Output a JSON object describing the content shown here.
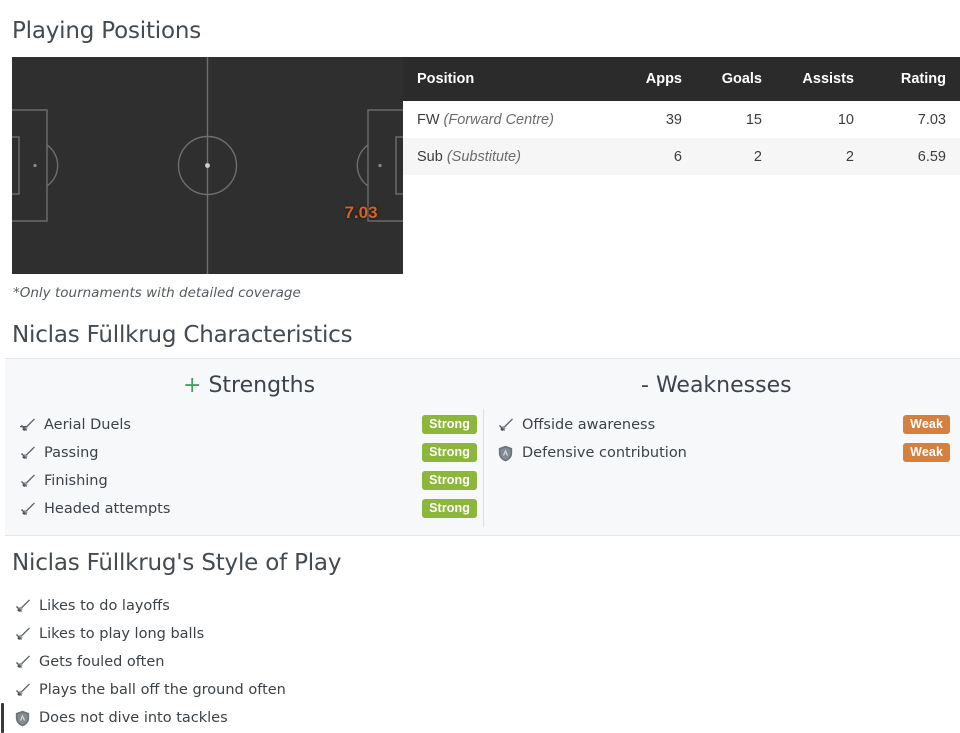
{
  "playing_positions": {
    "title": "Playing Positions",
    "footnote": "*Only tournaments with detailed coverage",
    "pitch": {
      "rating_marker": "7.03",
      "rating_color": "#d2622a",
      "background_color": "#2f2f2f",
      "line_color": "#6a6a6a"
    },
    "table": {
      "columns": [
        "Position",
        "Apps",
        "Goals",
        "Assists",
        "Rating"
      ],
      "rows": [
        {
          "code": "FW",
          "name": "(Forward Centre)",
          "apps": "39",
          "goals": "15",
          "assists": "10",
          "rating": "7.03"
        },
        {
          "code": "Sub",
          "name": "(Substitute)",
          "apps": "6",
          "goals": "2",
          "assists": "2",
          "rating": "6.59"
        }
      ]
    }
  },
  "characteristics": {
    "title": "Niclas Füllkrug Characteristics",
    "strengths": {
      "sign": "+",
      "heading": "Strengths",
      "items": [
        {
          "icon": "sword-icon",
          "label": "Aerial Duels",
          "badge": "Strong"
        },
        {
          "icon": "sword-icon",
          "label": "Passing",
          "badge": "Strong"
        },
        {
          "icon": "sword-icon",
          "label": "Finishing",
          "badge": "Strong"
        },
        {
          "icon": "sword-icon",
          "label": "Headed attempts",
          "badge": "Strong"
        }
      ]
    },
    "weaknesses": {
      "sign": "-",
      "heading": "Weaknesses",
      "items": [
        {
          "icon": "sword-icon",
          "label": "Offside awareness",
          "badge": "Weak"
        },
        {
          "icon": "shield-icon",
          "label": "Defensive contribution",
          "badge": "Weak"
        }
      ]
    },
    "badge_colors": {
      "strong": "#8cb63c",
      "weak": "#d4803f"
    }
  },
  "style_of_play": {
    "title": "Niclas Füllkrug's Style of Play",
    "items": [
      {
        "icon": "sword-icon",
        "label": "Likes to do layoffs"
      },
      {
        "icon": "sword-icon",
        "label": "Likes to play long balls"
      },
      {
        "icon": "sword-icon",
        "label": "Gets fouled often"
      },
      {
        "icon": "sword-icon",
        "label": "Plays the ball off the ground often"
      },
      {
        "icon": "shield-icon",
        "label": "Does not dive into tackles"
      }
    ]
  }
}
